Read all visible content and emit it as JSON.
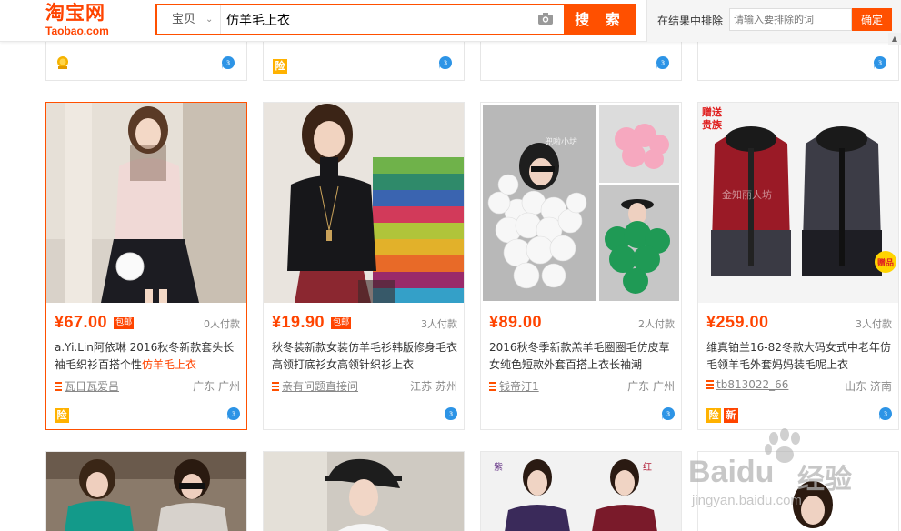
{
  "header": {
    "logo_cn": "淘宝网",
    "logo_en": "Taobao.com",
    "search_type": "宝贝",
    "search_query": "仿羊毛上衣",
    "search_button": "搜 索",
    "exclude_label": "在结果中排除",
    "exclude_placeholder": "请输入要排除的词",
    "exclude_button": "确定"
  },
  "top_row": [
    {
      "badge": "gold-medal-icon"
    },
    {
      "badge": "险"
    },
    {
      "badge": ""
    },
    {
      "badge": ""
    }
  ],
  "products": [
    {
      "price": "¥67.00",
      "postage": "包邮",
      "paid": "0人付款",
      "title_pre": "a.Yi.Lin阿依琳 2016秋冬新款套头长袖毛织衫百搭个性",
      "title_hl": "仿羊毛上衣",
      "shop": "瓦日瓦爱吕",
      "location": "广东 广州",
      "badges": [
        "险"
      ]
    },
    {
      "price": "¥19.90",
      "postage": "包邮",
      "paid": "3人付款",
      "title_pre": "秋冬装新款女装仿羊毛衫韩版修身毛衣高领打底衫女高领针织衫上衣",
      "title_hl": "",
      "shop": "亲有问题直接问",
      "location": "江苏 苏州",
      "badges": []
    },
    {
      "price": "¥89.00",
      "postage": "",
      "paid": "2人付款",
      "title_pre": "2016秋冬季新款羔羊毛圈圈毛仿皮草女纯色短款外套百搭上衣长袖潮",
      "title_hl": "",
      "shop": "钱帝汀1",
      "location": "广东 广州",
      "badges": []
    },
    {
      "price": "¥259.00",
      "postage": "",
      "paid": "3人付款",
      "title_pre": "维真铂兰16-82冬款大码女式中老年仿毛领羊毛外套妈妈装毛呢上衣",
      "title_hl": "",
      "shop": "tb813022_66",
      "location": "山东 济南",
      "badges": [
        "险",
        "新"
      ]
    }
  ],
  "photo_text": {
    "p3_overlay": "兜啦小坊",
    "p4_tag": "赠送",
    "p4_tag2": "贵族",
    "p4_watermark": "金知丽人坊",
    "p4_gift": "赠品"
  },
  "bottom_labels": {
    "purple": "紫",
    "red": "红"
  },
  "watermark": {
    "brand": "Baidu",
    "cn": "经验",
    "url": "jingyan.baidu.com"
  },
  "colors": {
    "accent": "#ff5000",
    "price": "#ff4400",
    "badge_bao": "#ffb200"
  }
}
